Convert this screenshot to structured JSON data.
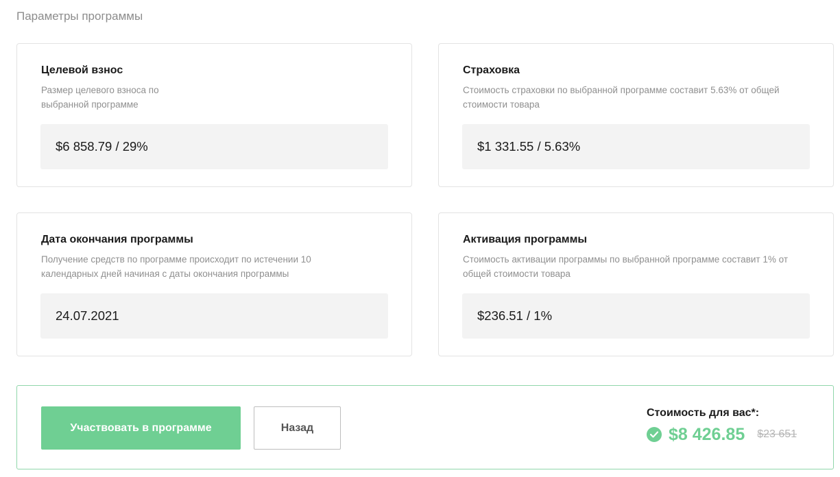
{
  "section_title": "Параметры программы",
  "cards": [
    {
      "title": "Целевой взнос",
      "description": "Размер целевого взноса по выбранной программе",
      "value": "$6 858.79 / 29%"
    },
    {
      "title": "Страховка",
      "description": "Стоимость страховки по выбранной программе составит 5.63% от общей стоимости товара",
      "value": "$1 331.55 / 5.63%"
    },
    {
      "title": "Дата окончания программы",
      "description": "Получение средств по программе происходит по истечении 10 календарных дней начиная с даты окончания программы",
      "value": "24.07.2021"
    },
    {
      "title": "Активация программы",
      "description": "Стоимость активации программы по выбранной программе составит 1% от общей стоимости товара",
      "value": "$236.51 / 1%"
    }
  ],
  "footer": {
    "participate_label": "Участвовать в программе",
    "back_label": "Назад",
    "price_label": "Стоимость для вас*:",
    "price_value": "$8 426.85",
    "price_old": "$23 651",
    "check_icon": "check-circle-icon"
  },
  "colors": {
    "accent_green": "#6fcf93",
    "footer_border": "#8fd6aa",
    "value_background": "#f3f3f3"
  }
}
